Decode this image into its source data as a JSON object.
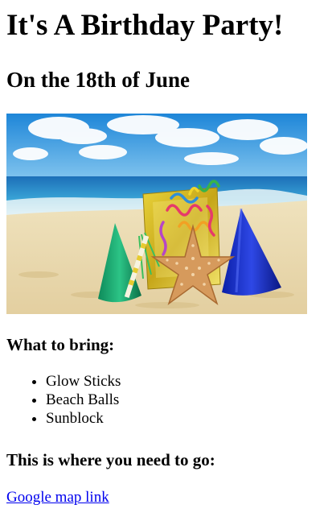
{
  "header": {
    "title": "It's A Birthday Party!",
    "date_line": "On the 18th of June"
  },
  "photo": {
    "alt": "Party hats, gift bag and starfish on a sandy beach"
  },
  "bring": {
    "heading": "What to bring:",
    "items": [
      "Glow Sticks",
      "Beach Balls",
      "Sunblock"
    ]
  },
  "location": {
    "heading": "This is where you need to go:",
    "link_label": "Google map link"
  }
}
